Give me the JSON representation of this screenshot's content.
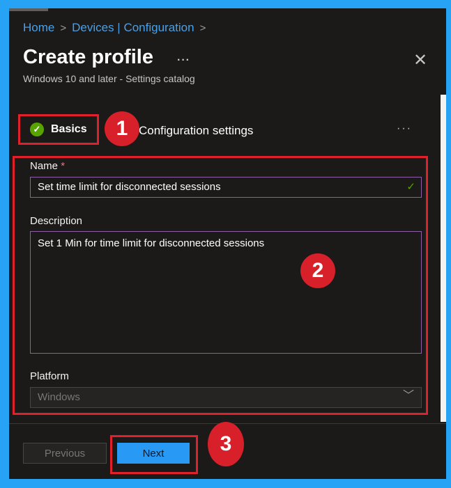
{
  "breadcrumb": [
    {
      "label": "Home"
    },
    {
      "label": "Devices | Configuration"
    }
  ],
  "header": {
    "title": "Create profile",
    "more": "···",
    "subtitle": "Windows 10 and later - Settings catalog",
    "close": "✕"
  },
  "tabs": [
    {
      "label": "Basics",
      "status": "complete"
    },
    {
      "label": "Configuration settings"
    }
  ],
  "tabs_more": "···",
  "form": {
    "name": {
      "label": "Name",
      "required": "*",
      "value": "Set time limit for disconnected sessions"
    },
    "description": {
      "label": "Description",
      "value": "Set 1 Min for time limit for disconnected sessions"
    },
    "platform": {
      "label": "Platform",
      "value": "Windows"
    }
  },
  "footer": {
    "previous": "Previous",
    "next": "Next"
  },
  "annotations": [
    "1",
    "2",
    "3"
  ],
  "colors": {
    "accent": "#2899f5",
    "annotation": "#d8202a",
    "frame": "#27a3f5"
  }
}
